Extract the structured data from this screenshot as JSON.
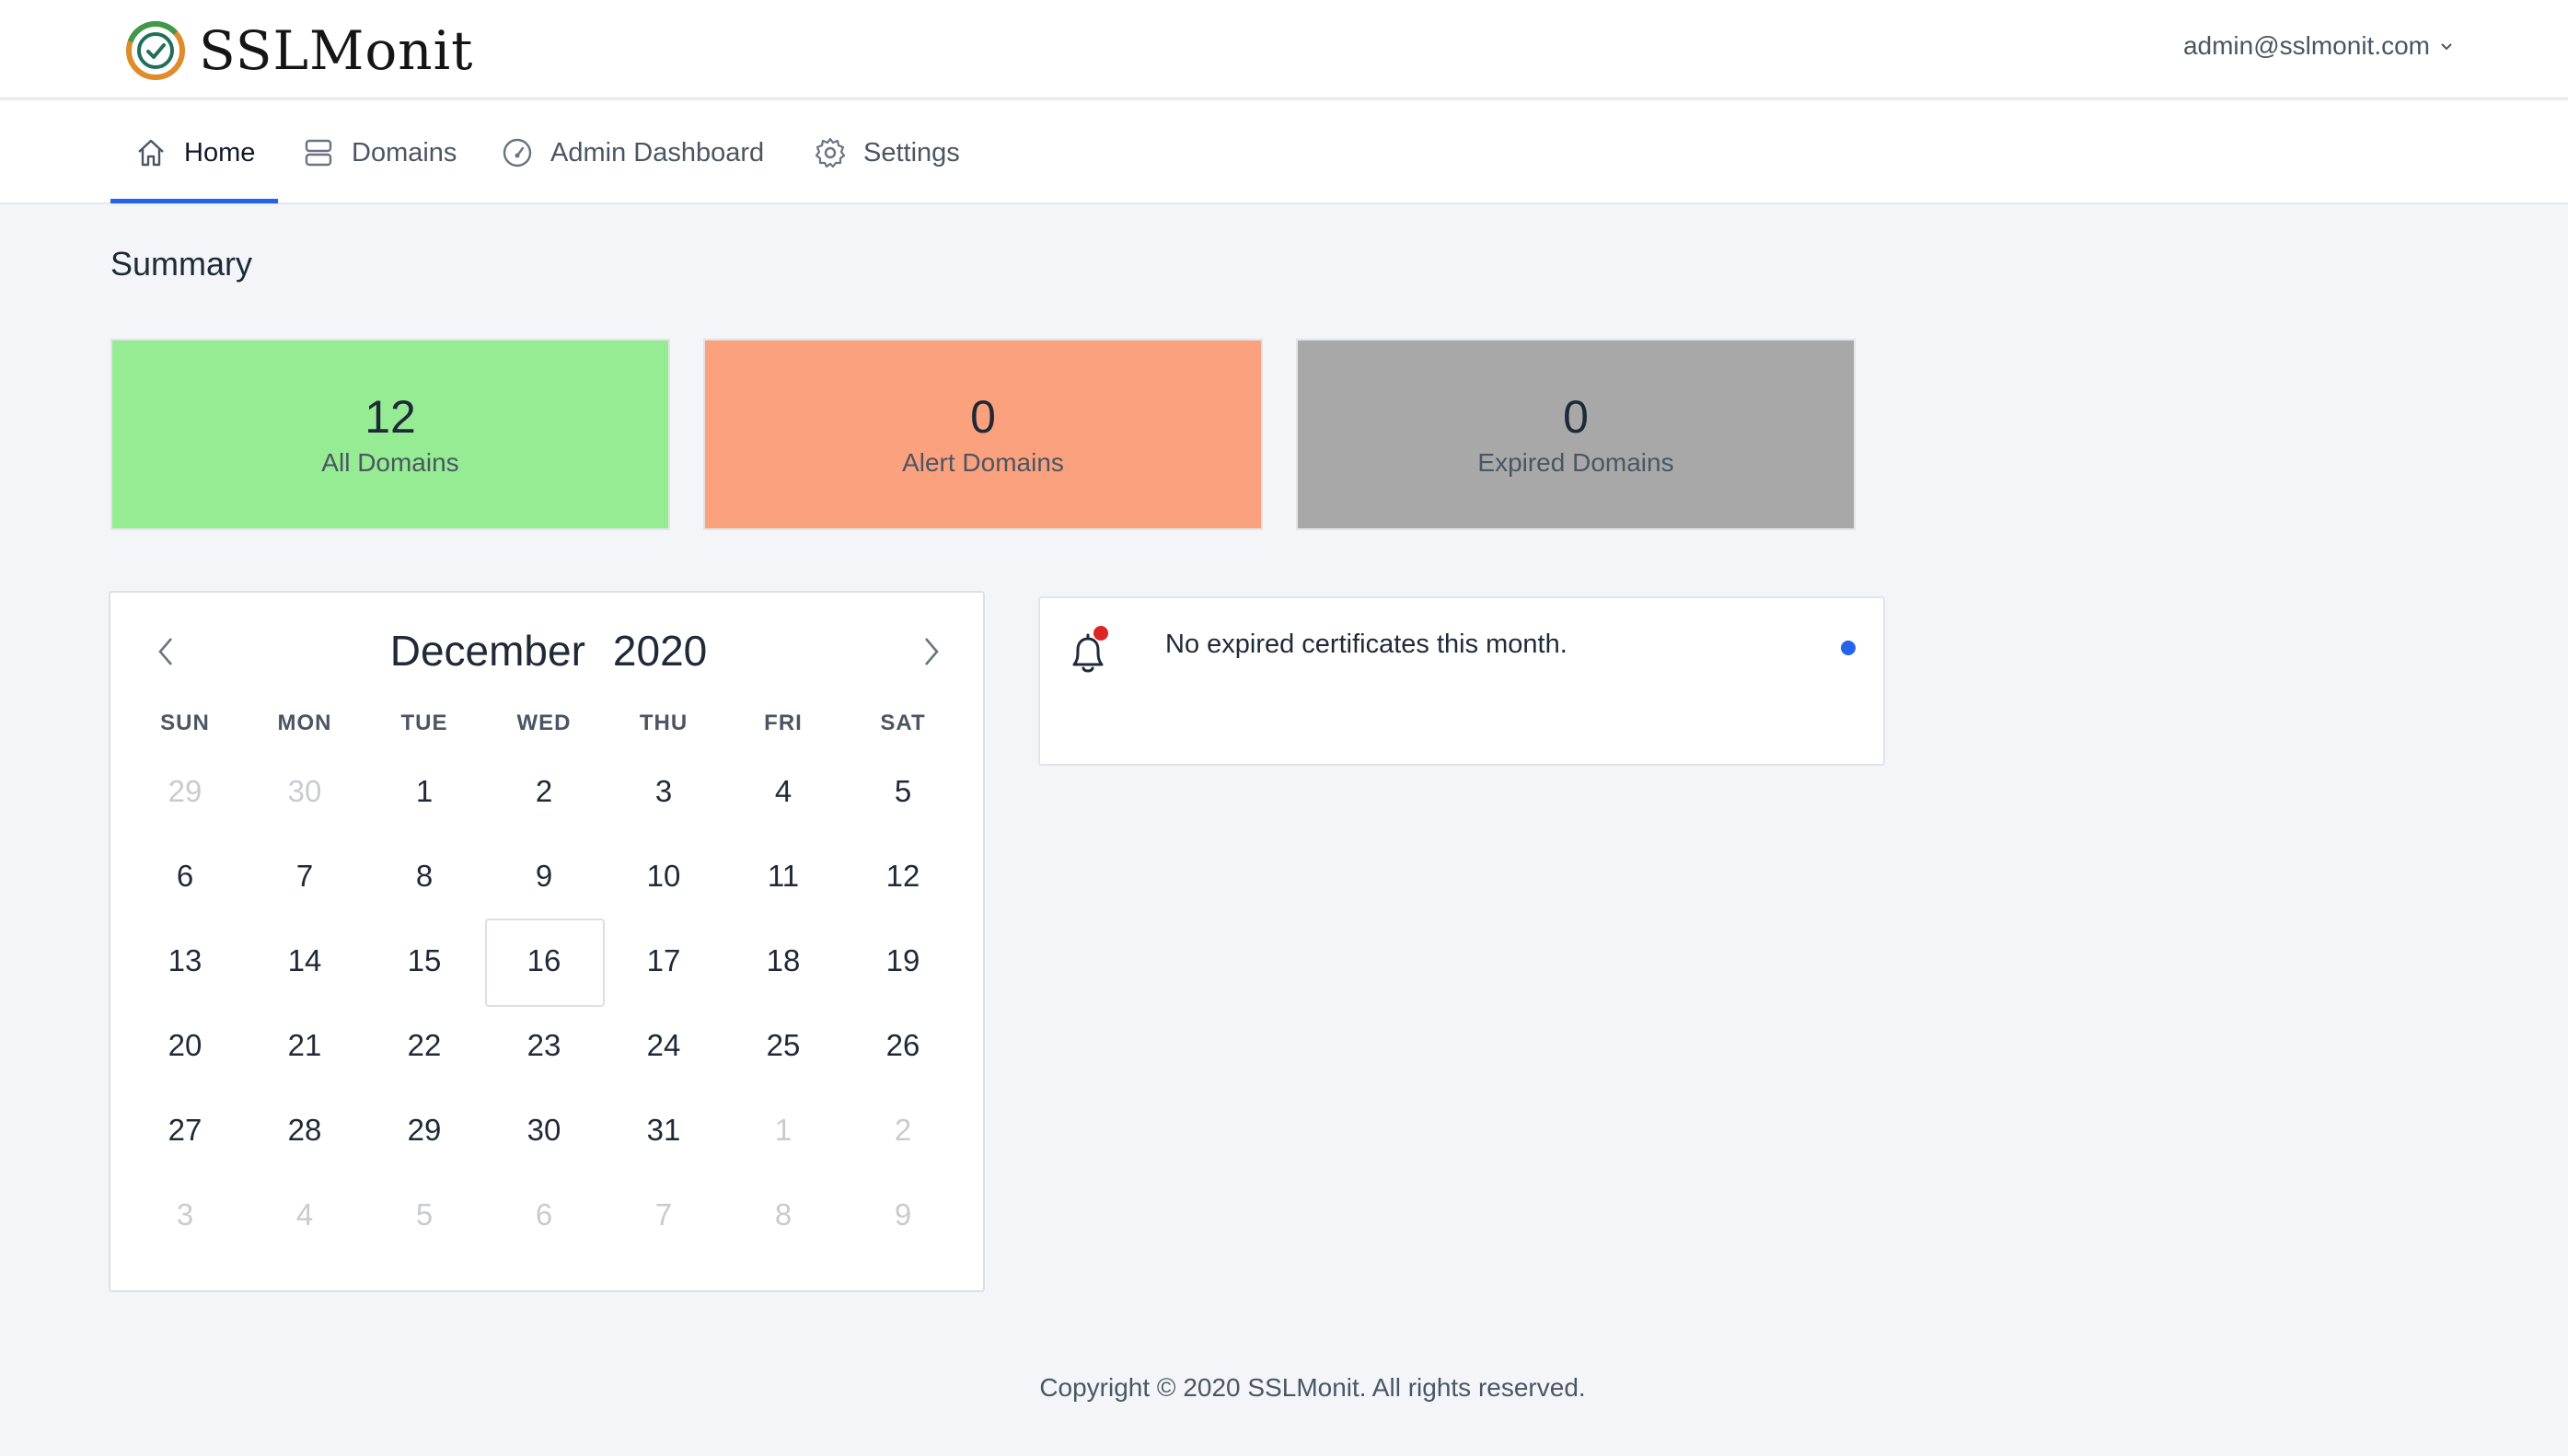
{
  "header": {
    "brand": "SSLMonit",
    "user_email": "admin@sslmonit.com"
  },
  "nav": {
    "items": [
      {
        "label": "Home",
        "icon": "home-icon",
        "active": true
      },
      {
        "label": "Domains",
        "icon": "server-icon",
        "active": false
      },
      {
        "label": "Admin Dashboard",
        "icon": "dashboard-icon",
        "active": false
      },
      {
        "label": "Settings",
        "icon": "gear-icon",
        "active": false
      }
    ]
  },
  "summary": {
    "title": "Summary",
    "cards": [
      {
        "value": "12",
        "label": "All Domains",
        "color": "#95ec92"
      },
      {
        "value": "0",
        "label": "Alert Domains",
        "color": "#fca17d"
      },
      {
        "value": "0",
        "label": "Expired Domains",
        "color": "#a8a8a8"
      }
    ]
  },
  "calendar": {
    "month": "December",
    "year": "2020",
    "weekdays": [
      "SUN",
      "MON",
      "TUE",
      "WED",
      "THU",
      "FRI",
      "SAT"
    ],
    "selected_day": "16",
    "weeks": [
      [
        {
          "d": "29",
          "m": true
        },
        {
          "d": "30",
          "m": true
        },
        {
          "d": "1"
        },
        {
          "d": "2"
        },
        {
          "d": "3"
        },
        {
          "d": "4"
        },
        {
          "d": "5"
        }
      ],
      [
        {
          "d": "6"
        },
        {
          "d": "7"
        },
        {
          "d": "8"
        },
        {
          "d": "9"
        },
        {
          "d": "10"
        },
        {
          "d": "11"
        },
        {
          "d": "12"
        }
      ],
      [
        {
          "d": "13"
        },
        {
          "d": "14"
        },
        {
          "d": "15"
        },
        {
          "d": "16",
          "t": true
        },
        {
          "d": "17"
        },
        {
          "d": "18"
        },
        {
          "d": "19"
        }
      ],
      [
        {
          "d": "20"
        },
        {
          "d": "21"
        },
        {
          "d": "22"
        },
        {
          "d": "23"
        },
        {
          "d": "24"
        },
        {
          "d": "25"
        },
        {
          "d": "26"
        }
      ],
      [
        {
          "d": "27"
        },
        {
          "d": "28"
        },
        {
          "d": "29"
        },
        {
          "d": "30"
        },
        {
          "d": "31"
        },
        {
          "d": "1",
          "m": true
        },
        {
          "d": "2",
          "m": true
        }
      ],
      [
        {
          "d": "3",
          "m": true
        },
        {
          "d": "4",
          "m": true
        },
        {
          "d": "5",
          "m": true
        },
        {
          "d": "6",
          "m": true
        },
        {
          "d": "7",
          "m": true
        },
        {
          "d": "8",
          "m": true
        },
        {
          "d": "9",
          "m": true
        }
      ]
    ]
  },
  "notification": {
    "message": "No expired certificates this month.",
    "badge_color": "#dc2626",
    "dot_color": "#2563eb"
  },
  "footer": {
    "text": "Copyright © 2020 SSLMonit. All rights reserved."
  },
  "colors": {
    "accent": "#2563eb",
    "background": "#f4f5f9"
  }
}
